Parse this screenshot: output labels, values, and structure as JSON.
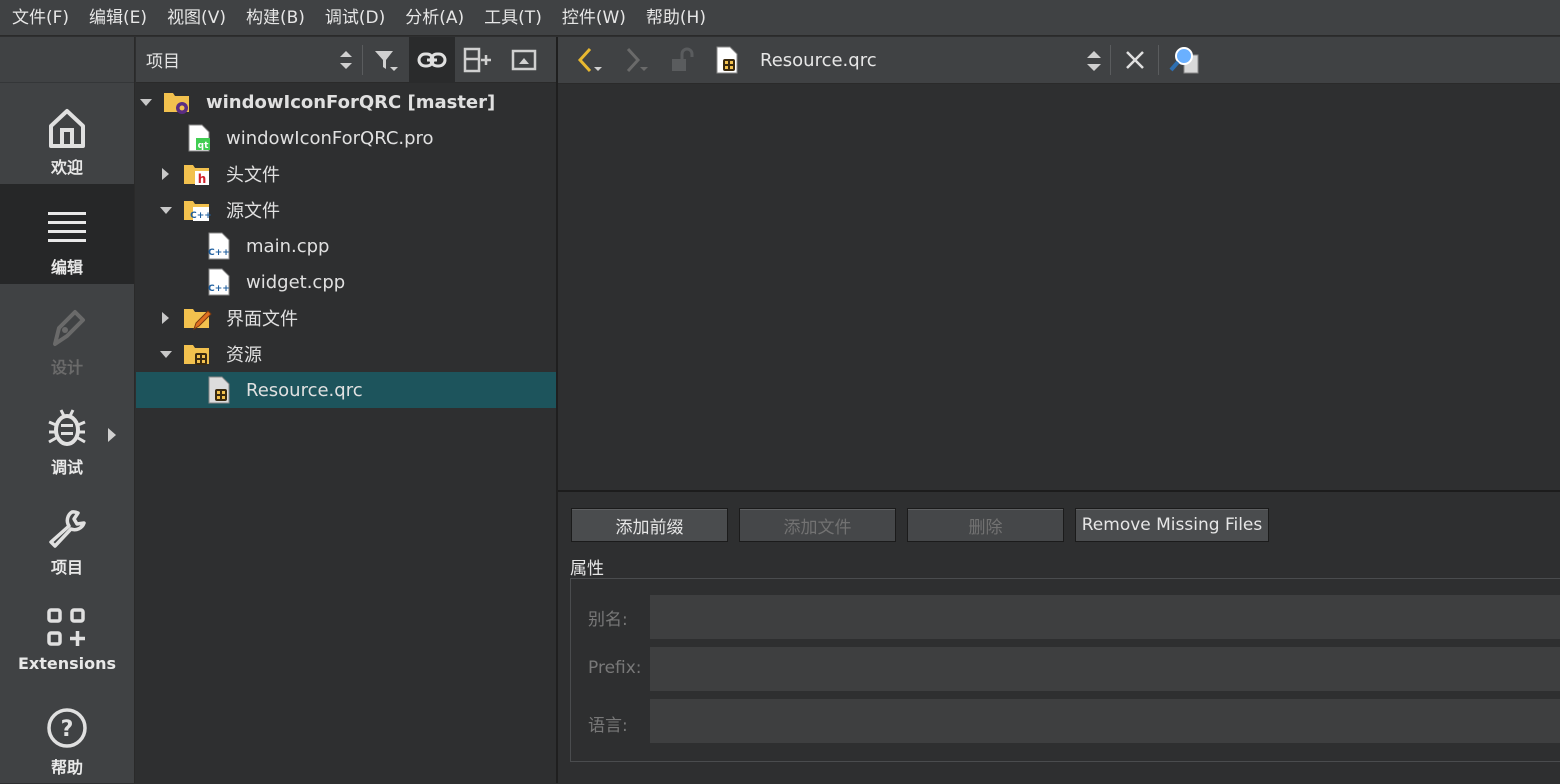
{
  "menu": [
    "文件(F)",
    "编辑(E)",
    "视图(V)",
    "构建(B)",
    "调试(D)",
    "分析(A)",
    "工具(T)",
    "控件(W)",
    "帮助(H)"
  ],
  "modes": [
    {
      "label": "欢迎",
      "icon": "home-icon",
      "active": false,
      "enabled": true
    },
    {
      "label": "编辑",
      "icon": "edit-lines-icon",
      "active": true,
      "enabled": true
    },
    {
      "label": "设计",
      "icon": "pen-icon",
      "active": false,
      "enabled": false
    },
    {
      "label": "调试",
      "icon": "bug-icon",
      "active": false,
      "enabled": true
    },
    {
      "label": "项目",
      "icon": "wrench-icon",
      "active": false,
      "enabled": true
    },
    {
      "label": "Extensions",
      "icon": "extensions-icon",
      "active": false,
      "enabled": true
    },
    {
      "label": "帮助",
      "icon": "help-icon",
      "active": false,
      "enabled": true
    }
  ],
  "project": {
    "title": "项目",
    "tree": {
      "root": "windowIconForQRC [master]",
      "pro_file": "windowIconForQRC.pro",
      "headers": "头文件",
      "sources": "源文件",
      "main_cpp": "main.cpp",
      "widget_cpp": "widget.cpp",
      "forms": "界面文件",
      "resources": "资源",
      "resource_qrc": "Resource.qrc"
    }
  },
  "editor": {
    "file_name": "Resource.qrc",
    "buttons": {
      "add_prefix": "添加前缀",
      "add_files": "添加文件",
      "remove": "删除",
      "remove_missing": "Remove Missing Files"
    },
    "properties": {
      "title": "属性",
      "alias_label": "别名:",
      "prefix_label": "Prefix:",
      "language_label": "语言:"
    }
  },
  "colors": {
    "selection": "#1d545c",
    "accent_yellow": "#e8b830",
    "folder": "#f2c14e"
  }
}
